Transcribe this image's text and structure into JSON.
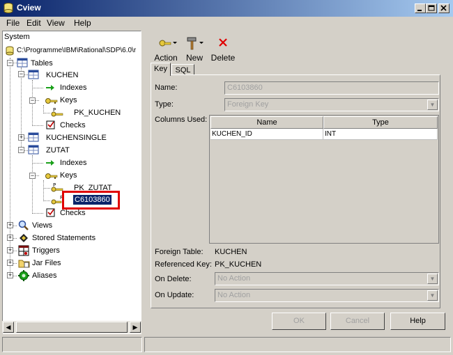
{
  "window": {
    "title": "Cview"
  },
  "menu": [
    "File",
    "Edit",
    "View",
    "Help"
  ],
  "tree": {
    "root": "System",
    "path": "C:\\Programme\\IBM\\Rational\\SDP\\6.0\\r",
    "tables": "Tables",
    "kuchen": "KUCHEN",
    "indexes": "Indexes",
    "keys": "Keys",
    "pk_kuchen": "PK_KUCHEN",
    "checks": "Checks",
    "kuchensingle": "KUCHENSINGLE",
    "zutat": "ZUTAT",
    "pk_zutat": "PK_ZUTAT",
    "fk_selected": "C6103860",
    "views": "Views",
    "stored": "Stored Statements",
    "triggers": "Triggers",
    "jarfiles": "Jar Files",
    "aliases": "Aliases",
    "key_prefix": "P",
    "fk_prefix": "F"
  },
  "toolbar": {
    "action": "Action",
    "new": "New",
    "delete": "Delete"
  },
  "tabs": {
    "key": "Key",
    "sql": "SQL"
  },
  "form": {
    "name_label": "Name:",
    "name_value": "C6103860",
    "type_label": "Type:",
    "type_value": "Foreign Key",
    "columns_label": "Columns Used:",
    "col_header_name": "Name",
    "col_header_type": "Type",
    "rows": [
      {
        "name": "KUCHEN_ID",
        "type": "INT"
      }
    ],
    "foreign_table_label": "Foreign Table:",
    "foreign_table_value": "KUCHEN",
    "ref_key_label": "Referenced Key:",
    "ref_key_value": "PK_KUCHEN",
    "on_delete_label": "On Delete:",
    "on_delete_value": "No Action",
    "on_update_label": "On Update:",
    "on_update_value": "No Action"
  },
  "buttons": {
    "ok": "OK",
    "cancel": "Cancel",
    "help": "Help"
  },
  "colors": {
    "title_start": "#0a246a",
    "title_end": "#a6caf0",
    "selection": "#0a246a",
    "highlight_box": "#e00000"
  }
}
